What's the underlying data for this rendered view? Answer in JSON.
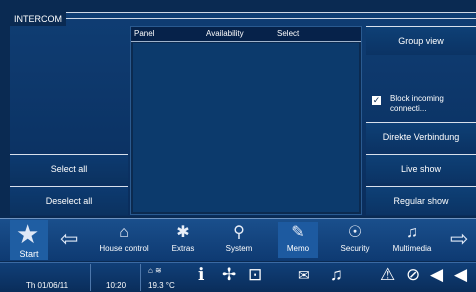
{
  "window": {
    "title": "INTERCOM"
  },
  "list": {
    "columns": [
      "Panel",
      "Availability",
      "Select"
    ]
  },
  "left_buttons": {
    "select_all": "Select all",
    "deselect_all": "Deselect all"
  },
  "right_buttons": {
    "group_view": "Group view",
    "block_incoming": "Block incoming connecti...",
    "block_checked": true,
    "direkte": "Direkte Verbindung",
    "live_show": "Live show",
    "regular_show": "Regular show"
  },
  "nav": {
    "start": "Start",
    "items": [
      {
        "label": "House control",
        "icon": "house-icon"
      },
      {
        "label": "Extras",
        "icon": "extras-icon"
      },
      {
        "label": "System",
        "icon": "system-icon"
      },
      {
        "label": "Memo",
        "icon": "memo-icon"
      },
      {
        "label": "Security",
        "icon": "security-icon"
      },
      {
        "label": "Multimedia",
        "icon": "multimedia-icon"
      }
    ]
  },
  "status": {
    "date": "Th 01/06/11",
    "time": "10:20",
    "temperature": "19.3 °C"
  }
}
